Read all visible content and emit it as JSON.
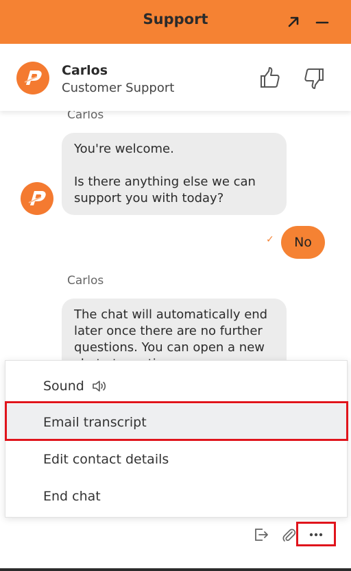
{
  "colors": {
    "brand": "#f58233",
    "highlight": "#e0141c",
    "bubble": "#ececec"
  },
  "topbar": {
    "title": "Support",
    "popout_icon": "arrow-up-right-icon",
    "minimize_icon": "minimize-icon"
  },
  "agent": {
    "name": "Carlos",
    "role": "Customer Support",
    "avatar_icon": "brand-logo-icon"
  },
  "rating": {
    "up_icon": "thumbs-up-icon",
    "down_icon": "thumbs-down-icon"
  },
  "messages": [
    {
      "sender": "Carlos",
      "text": "You're welcome.\n\nIs there anything else we can support you with today?"
    },
    {
      "sender": "user",
      "text": "No",
      "status_icon": "check-icon"
    },
    {
      "sender": "Carlos",
      "text": "The chat will automatically end later once there are no further questions. You can open a new chat at any time."
    }
  ],
  "menu": {
    "items": [
      {
        "label": "Sound",
        "icon": "speaker-icon"
      },
      {
        "label": "Email transcript",
        "highlighted": true
      },
      {
        "label": "Edit contact details"
      },
      {
        "label": "End chat"
      }
    ]
  },
  "toolbar": {
    "exit_icon": "exit-icon",
    "attach_icon": "paperclip-icon",
    "more_icon": "more-icon"
  }
}
